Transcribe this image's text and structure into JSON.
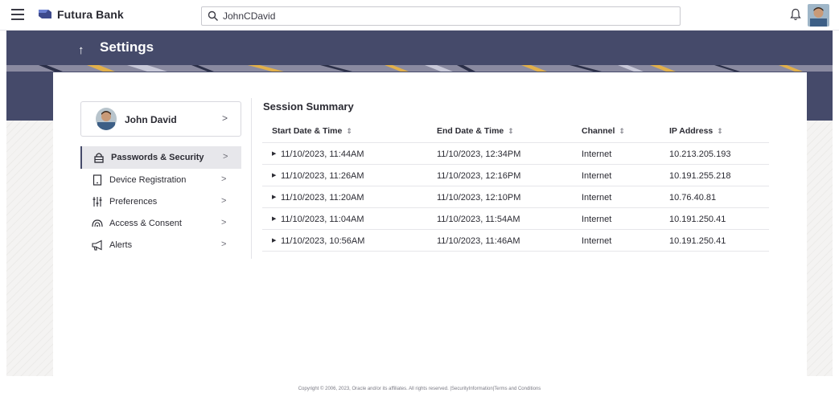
{
  "brand": {
    "name": "Futura Bank"
  },
  "search": {
    "value": "JohnCDavid"
  },
  "page": {
    "title": "Settings"
  },
  "profile": {
    "name": "John David"
  },
  "menu": [
    {
      "label": "Passwords & Security",
      "icon": "lock-icon",
      "active": true
    },
    {
      "label": "Device Registration",
      "icon": "device-icon",
      "active": false
    },
    {
      "label": "Preferences",
      "icon": "sliders-icon",
      "active": false
    },
    {
      "label": "Access & Consent",
      "icon": "access-icon",
      "active": false
    },
    {
      "label": "Alerts",
      "icon": "megaphone-icon",
      "active": false
    }
  ],
  "session": {
    "title": "Session Summary",
    "columns": [
      "Start Date & Time",
      "End Date & Time",
      "Channel",
      "IP Address"
    ],
    "rows": [
      {
        "start": "11/10/2023, 11:44AM",
        "end": "11/10/2023, 12:34PM",
        "channel": "Internet",
        "ip": "10.213.205.193"
      },
      {
        "start": "11/10/2023, 11:26AM",
        "end": "11/10/2023, 12:16PM",
        "channel": "Internet",
        "ip": "10.191.255.218"
      },
      {
        "start": "11/10/2023, 11:20AM",
        "end": "11/10/2023, 12:10PM",
        "channel": "Internet",
        "ip": "10.76.40.81"
      },
      {
        "start": "11/10/2023, 11:04AM",
        "end": "11/10/2023, 11:54AM",
        "channel": "Internet",
        "ip": "10.191.250.41"
      },
      {
        "start": "11/10/2023, 10:56AM",
        "end": "11/10/2023, 11:46AM",
        "channel": "Internet",
        "ip": "10.191.250.41"
      }
    ]
  },
  "footer": {
    "copyright": "Copyright © 2006, 2023, Oracle and/or its affiliates. All rights reserved.",
    "security_link": "SecurityInformation",
    "terms_link": "Terms and Conditions"
  },
  "colors": {
    "header": "#454a6a",
    "accent": "#e2b04a"
  }
}
